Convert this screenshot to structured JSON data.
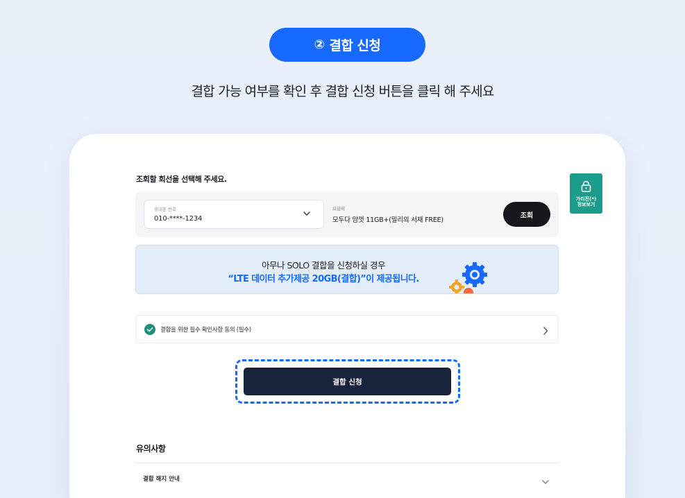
{
  "step": {
    "number": "②",
    "title": "결합 신청"
  },
  "subtitle": "결합 가능 여부를 확인 후 결합 신청 버튼을 클릭 해 주세요",
  "lookup": {
    "section_title": "조회할 회선을 선택해 주세요.",
    "phone_label": "휴대폰 번호",
    "phone_value": "010-****-1234",
    "plan_label": "요금제",
    "plan_value": "모두다 맘껏 11GB+(밀리의 서재 FREE)",
    "lookup_button": "조회"
  },
  "banner": {
    "line1": "아무나 SOLO 결합을 신청하실 경우",
    "line2": "“LTE 데이터 추가제공 20GB(결합)”이 제공됩니다."
  },
  "agreement": {
    "label": "결합을 위한 필수 확인사항 동의 (필수)",
    "checked": true
  },
  "apply_button": "결합 신청",
  "notice": {
    "title": "유의사항",
    "items": [
      {
        "label": "결합 해지 안내"
      }
    ]
  },
  "privacy_button": "가리진(*)\n정보보기",
  "colors": {
    "accent": "#1769ff",
    "dark_button": "#15171c",
    "apply_button": "#18223a",
    "privacy_green": "#1c9c8a",
    "check_green": "#1e8f78"
  },
  "icons": {
    "dropdown": "chevron-down-icon",
    "agree_check": "check-circle-icon",
    "agree_arrow": "chevron-right-icon",
    "privacy": "unlock-icon",
    "illustration": "gears-icon"
  }
}
